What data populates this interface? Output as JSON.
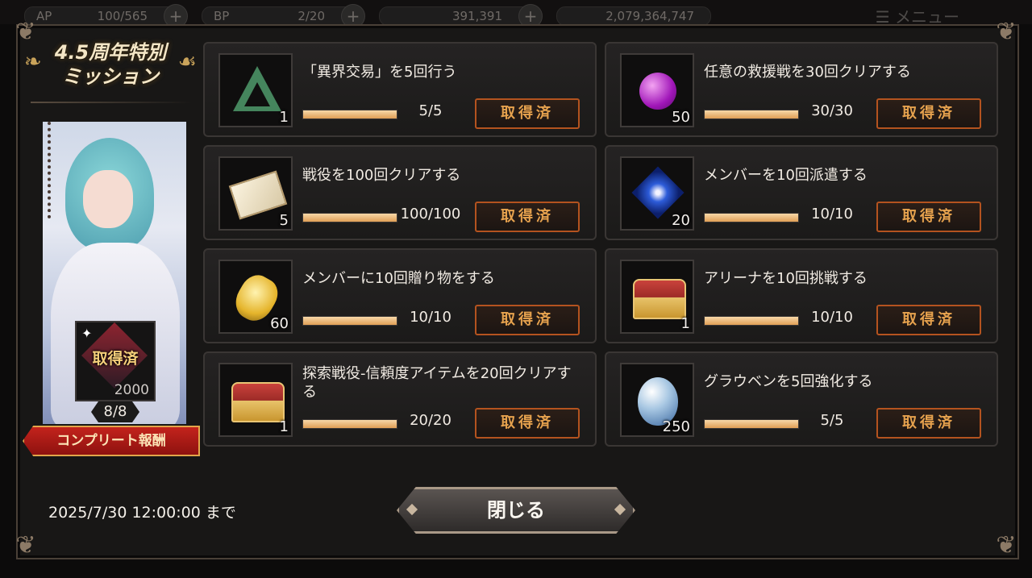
{
  "top_bar": {
    "resources": [
      {
        "label": "AP",
        "value": "100/565",
        "plus": "+"
      },
      {
        "label": "BP",
        "value": "2/20",
        "plus": "+"
      },
      {
        "label": "",
        "value": "391,391",
        "plus": "+"
      },
      {
        "label": "",
        "value": "2,079,364,747",
        "plus": ""
      }
    ],
    "menu_label": "☰ メニュー"
  },
  "event": {
    "title_line1": "4.5周年特別",
    "title_line2": "ミッション",
    "reward": {
      "status": "取得済",
      "quantity": "2000"
    },
    "progress_total": "8/8",
    "complete_reward_label": "コンプリート報酬"
  },
  "missions": [
    {
      "name": "「異界交易」を5回行う",
      "icon": "triangle-sigil-icon",
      "icon_qty": "1",
      "progress": "5/5",
      "fill": 1.0,
      "status": "取得済"
    },
    {
      "name": "任意の救援戦を30回クリアする",
      "icon": "purple-apple-icon",
      "icon_qty": "50",
      "progress": "30/30",
      "fill": 1.0,
      "status": "取得済"
    },
    {
      "name": "戦役を100回クリアする",
      "icon": "ticket-icon",
      "icon_qty": "5",
      "progress": "100/100",
      "fill": 1.0,
      "status": "取得済"
    },
    {
      "name": "メンバーを10回派遣する",
      "icon": "blue-flower-icon",
      "icon_qty": "20",
      "progress": "10/10",
      "fill": 1.0,
      "status": "取得済"
    },
    {
      "name": "メンバーに10回贈り物をする",
      "icon": "potion-bottle-icon",
      "icon_qty": "60",
      "progress": "10/10",
      "fill": 1.0,
      "status": "取得済"
    },
    {
      "name": "アリーナを10回挑戦する",
      "icon": "treasure-chest-icon",
      "icon_qty": "1",
      "progress": "10/10",
      "fill": 1.0,
      "status": "取得済"
    },
    {
      "name": "探索戦役-信頼度アイテムを20回クリアする",
      "icon": "treasure-chest-icon",
      "icon_qty": "1",
      "progress": "20/20",
      "fill": 1.0,
      "status": "取得済"
    },
    {
      "name": "グラウベンを5回強化する",
      "icon": "crystal-icon",
      "icon_qty": "250",
      "progress": "5/5",
      "fill": 1.0,
      "status": "取得済"
    }
  ],
  "footer": {
    "deadline": "2025/7/30 12:00:00 まで",
    "close_label": "閉じる"
  }
}
